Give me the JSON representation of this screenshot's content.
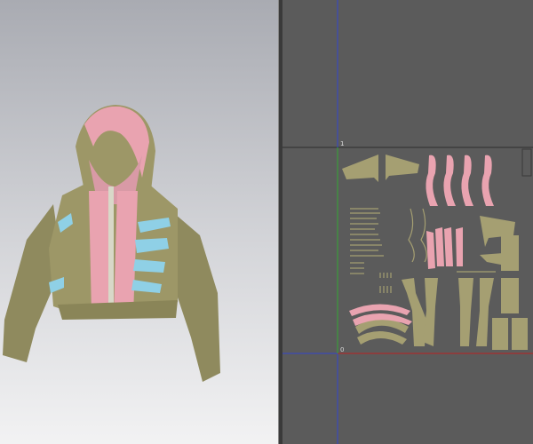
{
  "uv_editor": {
    "axis_label_top": "1",
    "axis_label_origin": "0"
  },
  "colors": {
    "fabric_khaki": "#a59f72",
    "fabric_pink": "#e9a3b0",
    "fabric_blue": "#8fd0e6",
    "axis_blue": "#3344cc",
    "axis_green": "#33aa33",
    "axis_red": "#bb2222"
  }
}
